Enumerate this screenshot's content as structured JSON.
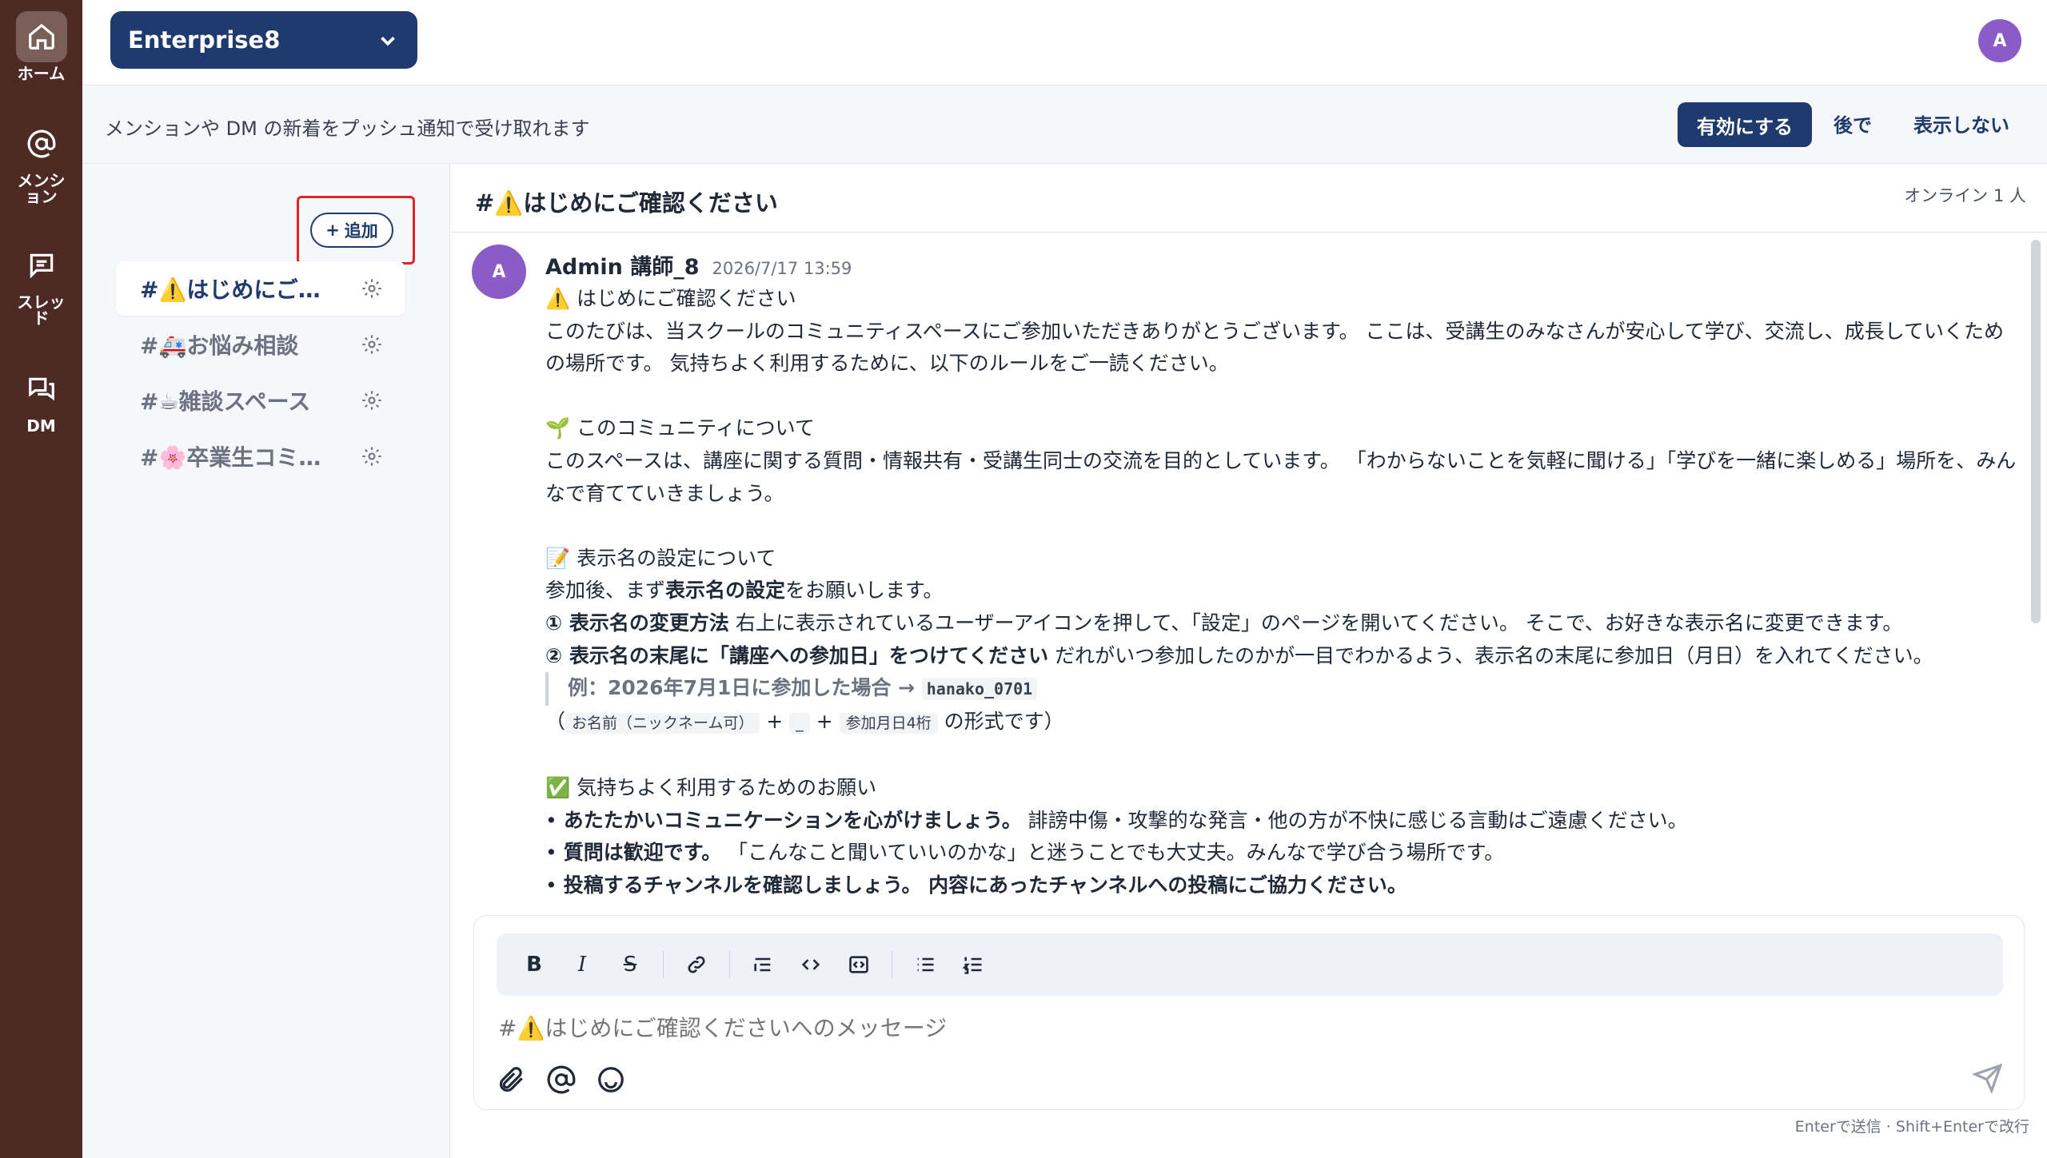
{
  "rail": {
    "home_label": "ホーム",
    "mention_label": "メンション",
    "thread_label": "スレッド",
    "dm_label": "DM"
  },
  "header": {
    "workspace": "Enterprise8",
    "avatar_initial": "A"
  },
  "notify": {
    "text": "メンションや DM の新着をプッシュ通知で受け取れます",
    "enable": "有効にする",
    "later": "後で",
    "hide": "表示しない"
  },
  "sidebar": {
    "add_label": "追加",
    "channels": [
      {
        "name": "#⚠️はじめにご確認ください",
        "active": true
      },
      {
        "name": "#🚑お悩み相談",
        "active": false
      },
      {
        "name": "#☕雑談スペース",
        "active": false
      },
      {
        "name": "#🌸卒業生コミュニティ",
        "active": false
      }
    ]
  },
  "channel": {
    "title": "#⚠️はじめにご確認ください",
    "online": "オンライン 1 人"
  },
  "message": {
    "avatar_initial": "A",
    "author": "Admin 講師_8",
    "time": "2026/7/17 13:59",
    "line_title": "⚠️ はじめにご確認ください",
    "line_intro": "このたびは、当スクールのコミュニティスペースにご参加いただきありがとうございます。 ここは、受講生のみなさんが安心して学び、交流し、成長していくための場所です。 気持ちよく利用するために、以下のルールをご一読ください。",
    "section_about": "🌱 このコミュニティについて",
    "about_text": "このスペースは、講座に関する質問・情報共有・受講生同士の交流を目的としています。 「わからないことを気軽に聞ける」「学びを一緒に楽しめる」場所を、みんなで育てていきましょう。",
    "section_name": "📝 表示名の設定について",
    "name_intro_prefix": "参加後、まず",
    "name_intro_bold": "表示名の設定",
    "name_intro_suffix": "をお願いします。",
    "step1_bold": "① 表示名の変更方法",
    "step1_text": " 右上に表示されているユーザーアイコンを押して、「設定」のページを開いてください。 そこで、お好きな表示名に変更できます。",
    "step2_bold": "② 表示名の末尾に「講座への参加日」をつけてください",
    "step2_text": " だれがいつ参加したのかが一目でわかるよう、表示名の末尾に参加日（月日）を入れてください。",
    "example_text": "例：2026年7月1日に参加した場合 → ",
    "example_code": "hanako_0701",
    "format_open": "（",
    "format_tag1": "お名前（ニックネーム可）",
    "format_plus1": " + ",
    "format_tag2": "_",
    "format_plus2": " + ",
    "format_tag3": "参加月日4桁",
    "format_close": " の形式です）",
    "section_rules": "✅ 気持ちよく利用するためのお願い",
    "rule1_bold": "あたたかいコミュニケーションを心がけましょう。",
    "rule1_text": " 誹謗中傷・攻撃的な発言・他の方が不快に感じる言動はご遠慮ください。",
    "rule2_bold": "質問は歓迎です。",
    "rule2_text": " 「こんなこと聞いていいのかな」と迷うことでも大丈夫。みんなで学び合う場所です。",
    "rule3_text": "投稿するチャンネルを確認しましょう。 内容にあったチャンネルへの投稿にご協力ください。"
  },
  "composer": {
    "placeholder": "#⚠️はじめにご確認くださいへのメッセージ",
    "hint": "Enterで送信 · Shift+Enterで改行"
  }
}
